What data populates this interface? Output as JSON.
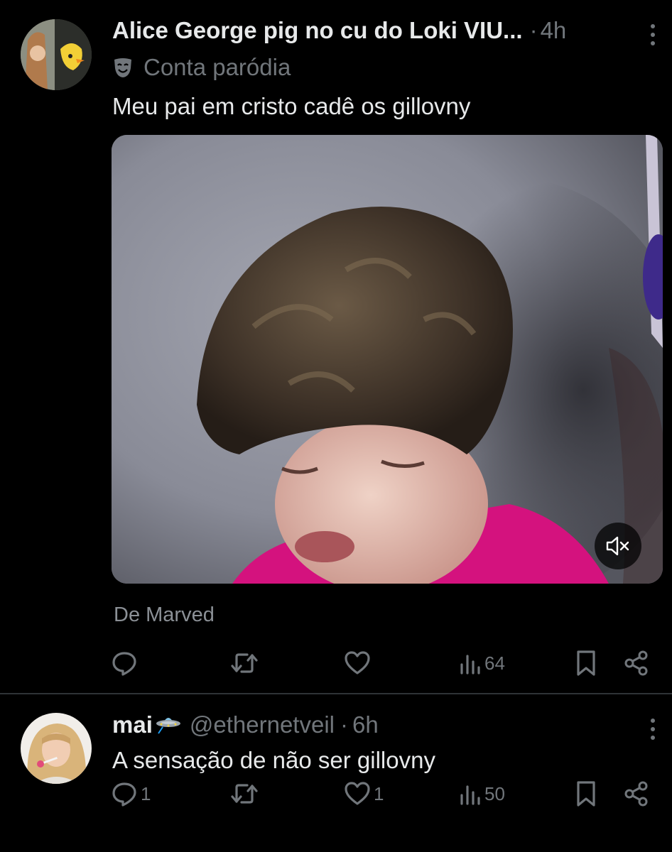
{
  "tweets": [
    {
      "display_name": "Alice George pig no cu do Loki VIU...",
      "separator": "·",
      "time": "4h",
      "badge_label": "Conta paródia",
      "text": "Meu pai em cristo cadê os gillovny",
      "attribution": "De Marved",
      "views": "64",
      "media_muted": true
    },
    {
      "display_name": "mai",
      "name_emoji": "ufo-icon",
      "handle": "@ethernetveil",
      "separator": "·",
      "time": "6h",
      "text": "A sensação de não ser gillovny",
      "replies": "1",
      "likes": "1",
      "views": "50"
    }
  ],
  "colors": {
    "background": "#000000",
    "text_primary": "#e7e9ea",
    "text_secondary": "#71767b",
    "divider": "#2f3336",
    "media_shirt": "#d4127e"
  }
}
